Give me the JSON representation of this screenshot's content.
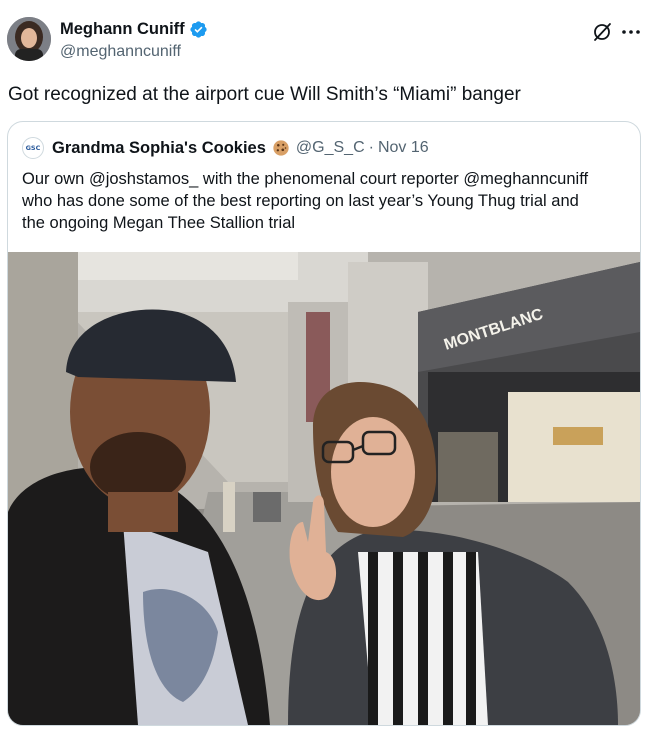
{
  "post": {
    "author_name": "Meghann Cuniff",
    "author_handle": "@meghanncuniff",
    "text": "Got recognized at the airport cue Will Smith’s “Miami” banger"
  },
  "quoted_post": {
    "author_name": "Grandma Sophia's Cookies",
    "avatar_text": "GSC",
    "author_handle": "@G_S_C",
    "separator": "·",
    "date": "Nov 16",
    "text": "Our own @joshstamos_ with the phenomenal court reporter @meghanncuniff\nwho has done some of the best reporting on last year’s Young Thug trial and\nthe ongoing Megan Thee Stallion trial",
    "photo": {
      "sign_text": "MONTBLANC"
    }
  },
  "icons": {
    "verified": "verified-badge-icon",
    "grok": "grok-icon",
    "more": "more-icon",
    "cookie": "cookie-emoji-icon"
  },
  "colors": {
    "verified": "#1d9bf0",
    "secondary_text": "#536471",
    "border": "#cfd9de"
  }
}
